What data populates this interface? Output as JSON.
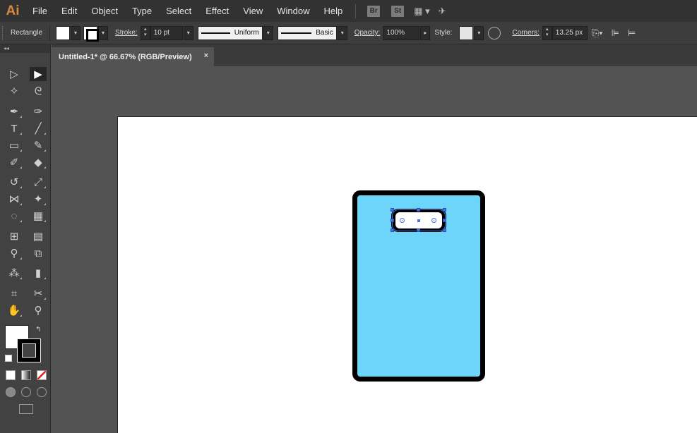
{
  "app": {
    "logo": "Ai"
  },
  "menu": [
    "File",
    "Edit",
    "Object",
    "Type",
    "Select",
    "Effect",
    "View",
    "Window",
    "Help"
  ],
  "menu_apps": {
    "bridge": "Br",
    "stock": "St"
  },
  "control": {
    "object_type": "Rectangle",
    "stroke_label": "Stroke:",
    "stroke_value": "10 pt",
    "profile_uniform": "Uniform",
    "brush_basic": "Basic",
    "opacity_label": "Opacity:",
    "opacity_value": "100%",
    "style_label": "Style:",
    "corners_label": "Corners:",
    "corners_value": "13.25 px"
  },
  "tools_panel": {
    "collapse": "◂◂"
  },
  "document": {
    "tab_title": "Untitled-1* @ 66.67% (RGB/Preview)",
    "close": "×"
  },
  "colors": {
    "phone_fill": "#6dd5f9",
    "phone_stroke": "#000000",
    "selection": "#4a74e6",
    "artboard": "#ffffff",
    "workspace": "#535353"
  }
}
